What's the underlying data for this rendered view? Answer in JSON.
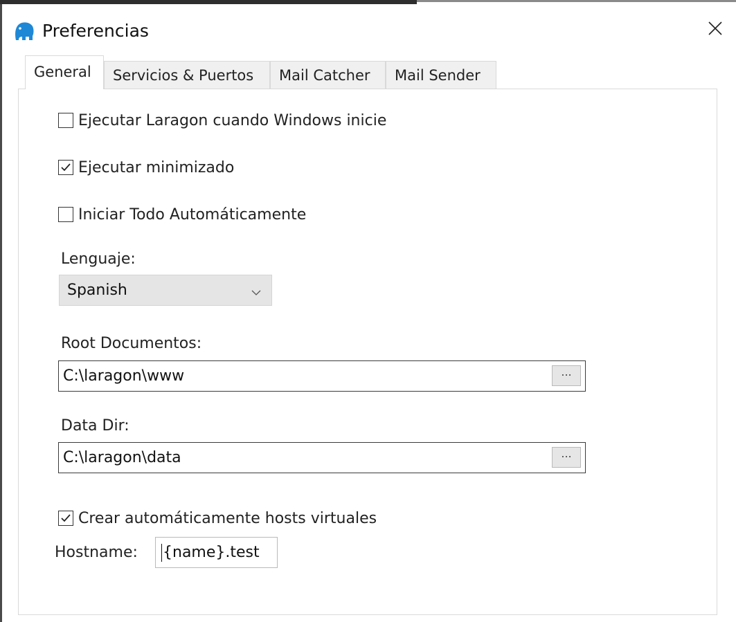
{
  "window": {
    "title": "Preferencias",
    "app_icon": "laragon-elephant-icon",
    "close_icon": "close-icon",
    "accent": "#1e88d6"
  },
  "tabs": [
    {
      "label": "General",
      "active": true
    },
    {
      "label": "Servicios & Puertos",
      "active": false
    },
    {
      "label": "Mail Catcher",
      "active": false
    },
    {
      "label": "Mail Sender",
      "active": false
    }
  ],
  "general": {
    "run_on_startup": {
      "label": "Ejecutar Laragon cuando Windows inicie",
      "checked": false
    },
    "run_minimized": {
      "label": "Ejecutar minimizado",
      "checked": true
    },
    "start_all": {
      "label": "Iniciar Todo Automáticamente",
      "checked": false
    },
    "language": {
      "label": "Lenguaje:",
      "value": "Spanish"
    },
    "document_root": {
      "label": "Root Documentos:",
      "value": "C:\\laragon\\www",
      "browse": "..."
    },
    "data_dir": {
      "label": "Data Dir:",
      "value": "C:\\laragon\\data",
      "browse": "..."
    },
    "auto_vhosts": {
      "label": "Crear automáticamente hosts virtuales",
      "checked": true
    },
    "hostname": {
      "label": "Hostname:",
      "value": "{name}.test"
    }
  }
}
